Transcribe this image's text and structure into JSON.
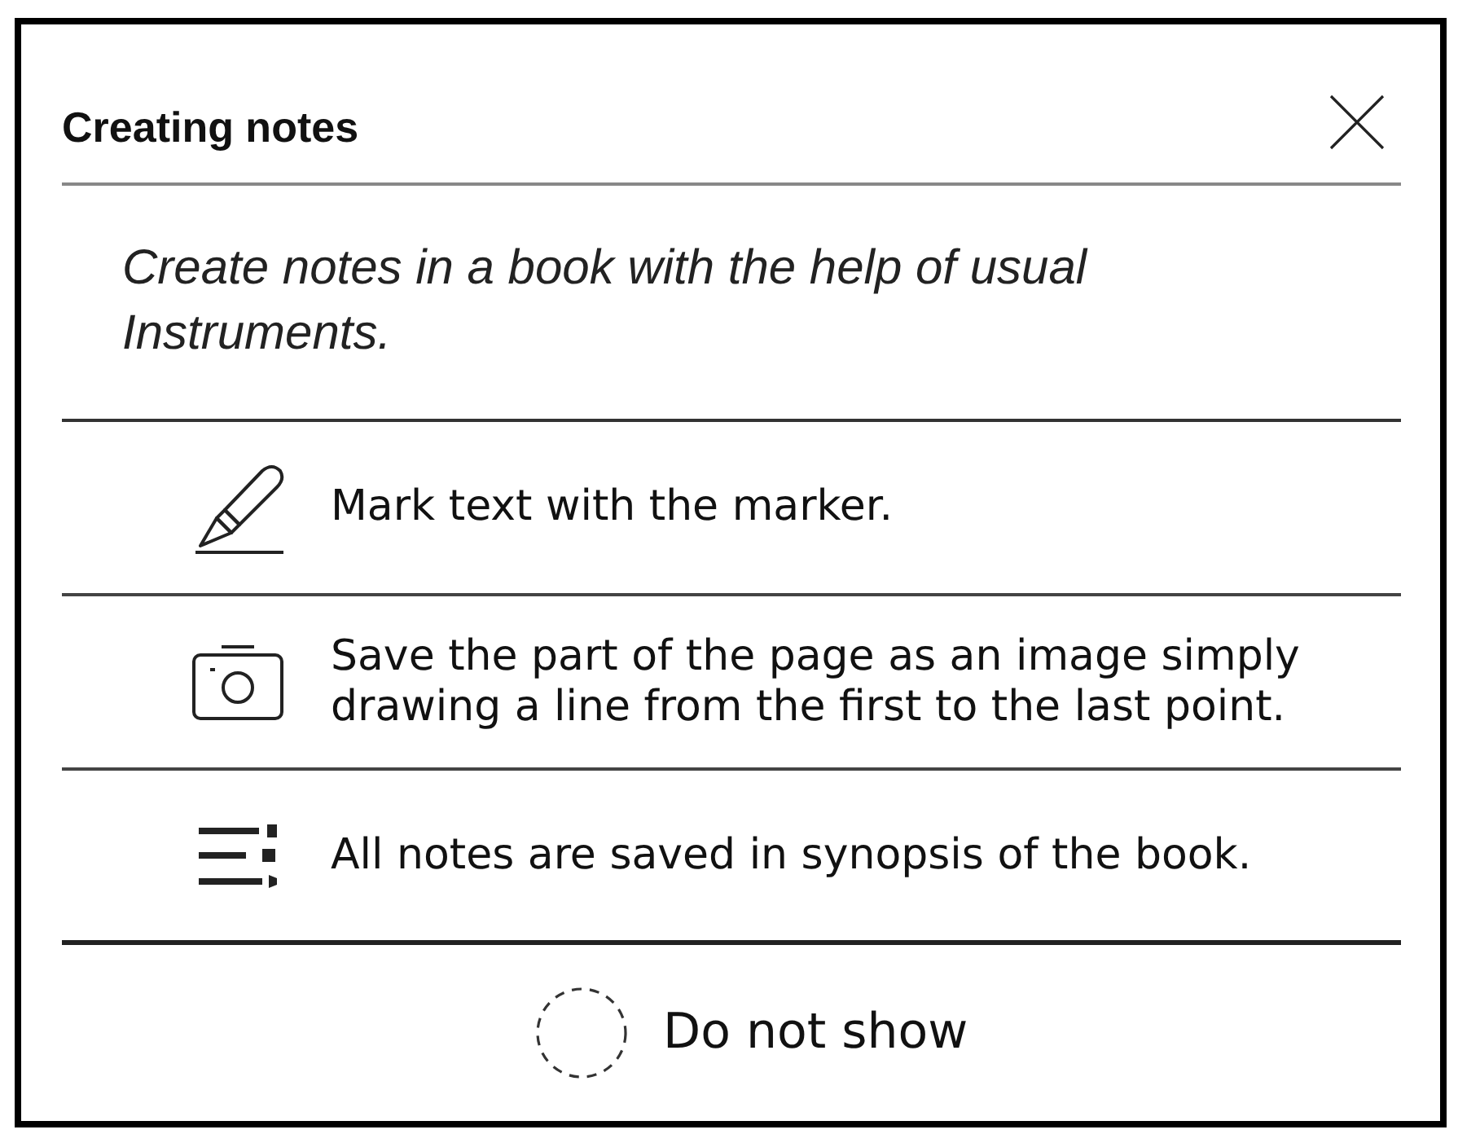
{
  "dialog": {
    "title": "Creating notes",
    "intro": "Create notes in a book with the help of usual Instruments."
  },
  "tips": [
    {
      "kind": "marker",
      "text": "Mark text with the marker."
    },
    {
      "kind": "camera",
      "text": "Save the part of the page as an image simply drawing a line from the first to the last point."
    },
    {
      "kind": "list",
      "text": "All notes are saved in synopsis of the book."
    }
  ],
  "do_not_show": {
    "label": "Do not show",
    "checked": false
  }
}
